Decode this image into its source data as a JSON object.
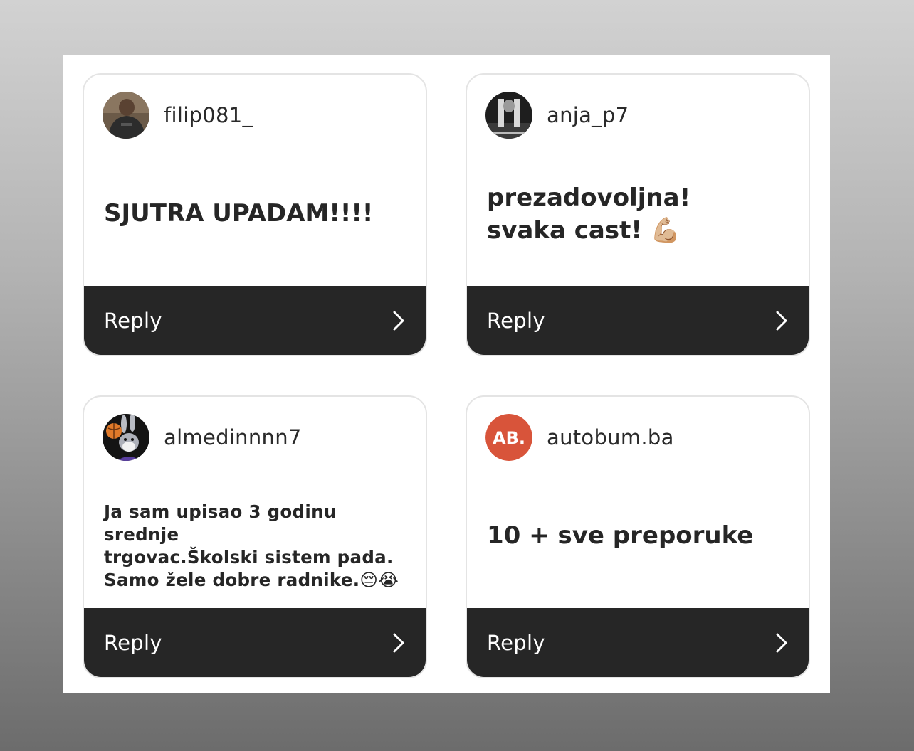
{
  "cards": [
    {
      "username": "filip081_",
      "message": "SJUTRA UPADAM!!!!",
      "reply_label": "Reply",
      "avatar": "person-dark-shirt-photo"
    },
    {
      "username": "anja_p7",
      "message": "prezadovoljna!\nsvaka cast! 💪🏼",
      "reply_label": "Reply",
      "avatar": "grayscale-photo"
    },
    {
      "username": "almedinnnn7",
      "message": "Ja sam upisao 3 godinu srednje\ntrgovac.Školski sistem pada.\nSamo žele dobre radnike.😔😭",
      "reply_label": "Reply",
      "avatar": "cartoon-rabbit-basketball"
    },
    {
      "username": "autobum.ba",
      "message": "10 + sve preporuke",
      "reply_label": "Reply",
      "avatar": "brand-logo",
      "avatar_text": "AB.",
      "avatar_color": "#d8543a"
    }
  ],
  "colors": {
    "reply_bar": "#262626",
    "card_bg": "#ffffff",
    "text": "#262626"
  }
}
